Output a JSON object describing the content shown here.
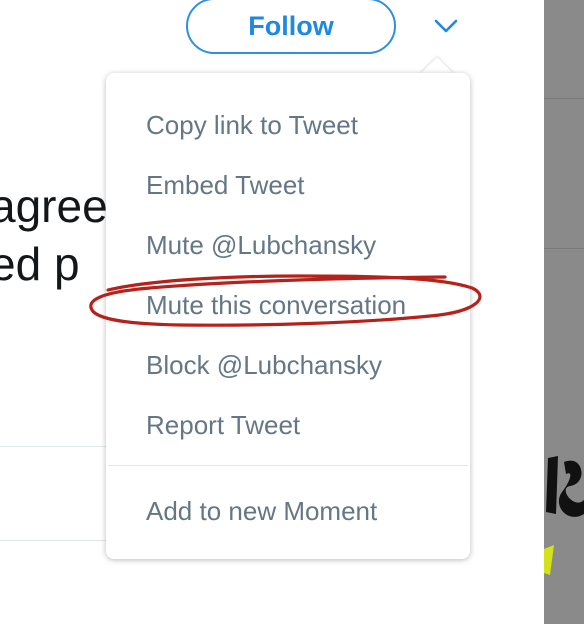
{
  "header": {
    "follow_label": "Follow"
  },
  "tweet": {
    "text_fragment_line1": "agree",
    "text_fragment_line2": "ed p"
  },
  "menu": {
    "items": [
      {
        "label": "Copy link to Tweet"
      },
      {
        "label": "Embed Tweet"
      },
      {
        "label": "Mute @Lubchansky"
      },
      {
        "label": "Mute this conversation"
      },
      {
        "label": "Block @Lubchansky"
      },
      {
        "label": "Report Tweet"
      },
      {
        "label": "Add to new Moment"
      }
    ]
  },
  "icons": {
    "dropdown": "chevron-down-icon"
  },
  "colors": {
    "accent": "#1e88e5",
    "menu_text": "#657786",
    "annotation": "#b5221b"
  }
}
